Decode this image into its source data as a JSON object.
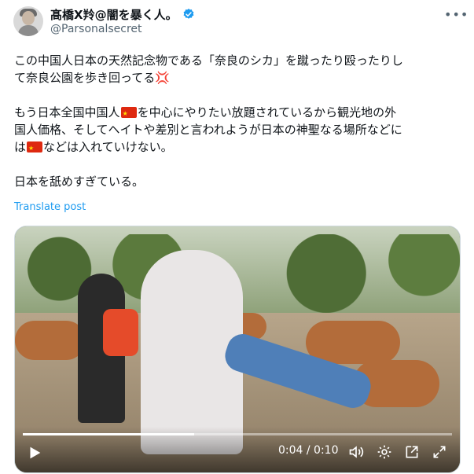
{
  "post": {
    "display_name": "髙橋X羚@闇を暴く人。",
    "handle": "@Parsonalsecret",
    "more_icon": "more-icon",
    "verified_color": "#1d9bf0"
  },
  "body": {
    "line1": "この中国人日本の天然記念物である「奈良のシカ」を蹴ったり殴ったりし",
    "line2": "て奈良公園を歩き回ってる",
    "line2_emoji": "💢",
    "line3_pre": "もう日本全国中国人",
    "line3_post": "を中心にやりたい放題されているから観光地の外",
    "line4": "国人価格、そしてヘイトや差別と言われようが日本の神聖なる場所などに",
    "line5_pre": "は",
    "line5_post": "などは入れていけない。",
    "line6": "日本を舐めすぎている。"
  },
  "translate_label": "Translate post",
  "video": {
    "time": "0:04 / 0:10",
    "progress": 0.4,
    "icons": [
      "play-icon",
      "volume-icon",
      "settings-icon",
      "popout-icon",
      "fullscreen-icon"
    ]
  }
}
